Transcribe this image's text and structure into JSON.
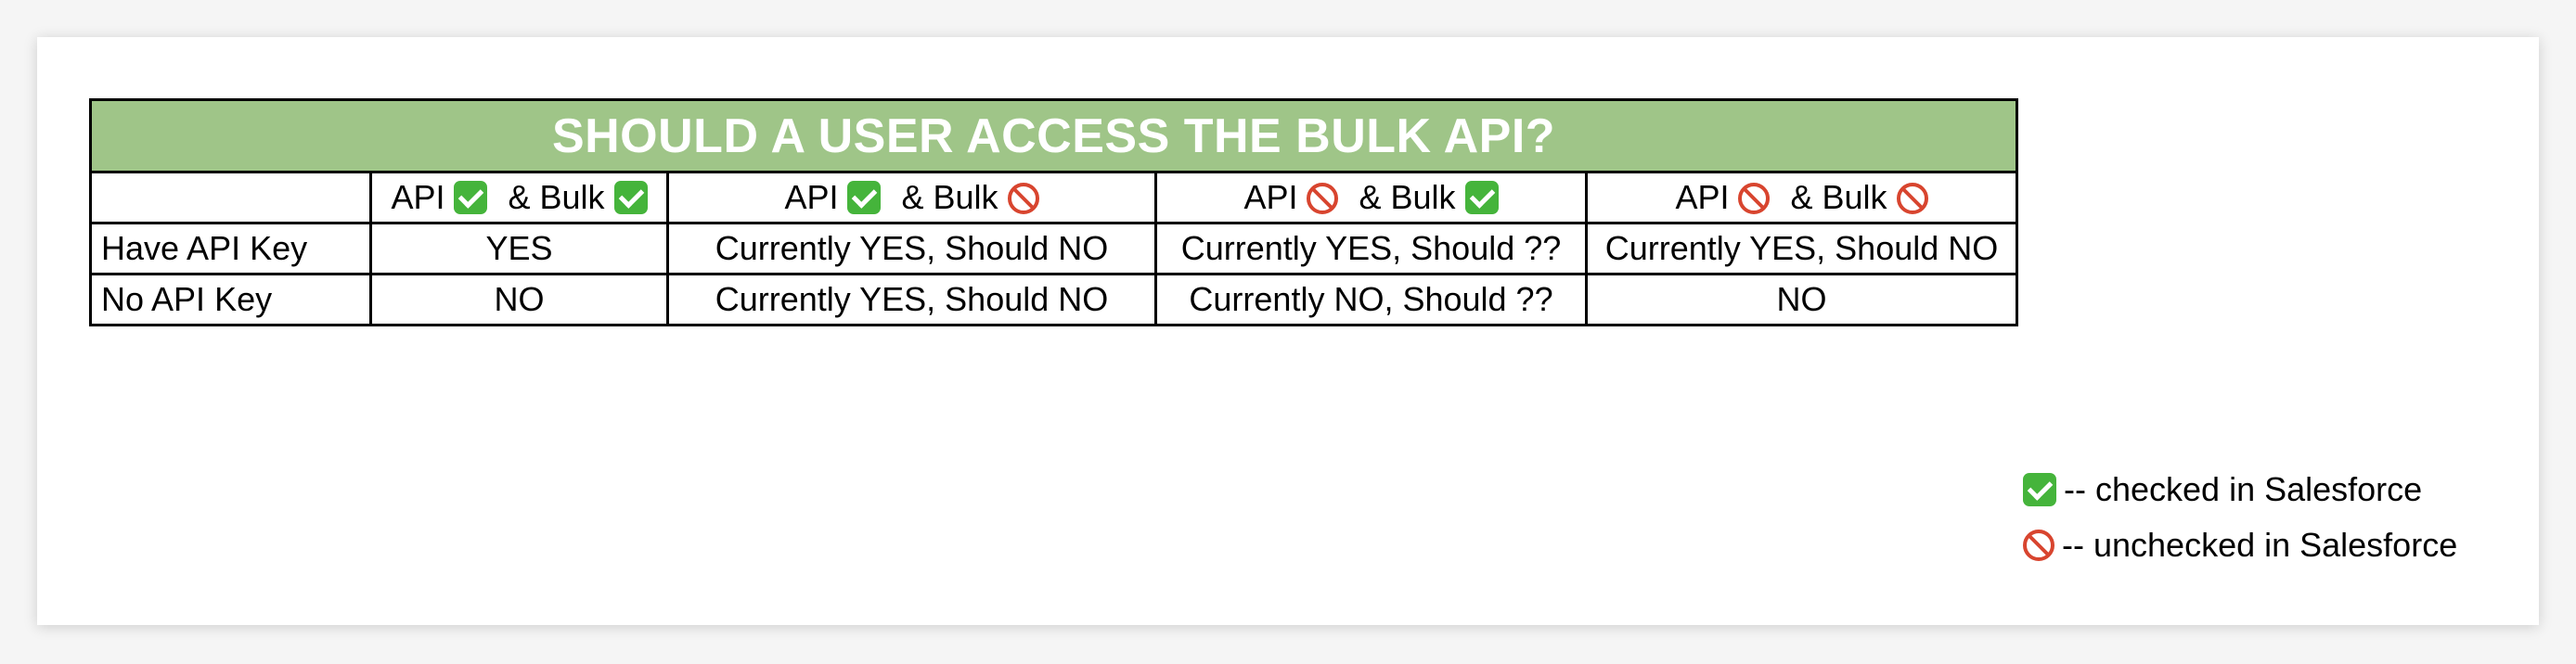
{
  "title": "SHOULD A USER ACCESS THE BULK API?",
  "columns": [
    {
      "api": "API",
      "api_icon": "checked-icon",
      "bulk": "& Bulk",
      "bulk_icon": "checked-icon"
    },
    {
      "api": "API",
      "api_icon": "checked-icon",
      "bulk": "& Bulk",
      "bulk_icon": "unchecked-icon"
    },
    {
      "api": "API",
      "api_icon": "unchecked-icon",
      "bulk": "& Bulk",
      "bulk_icon": "checked-icon"
    },
    {
      "api": "API",
      "api_icon": "unchecked-icon",
      "bulk": "& Bulk",
      "bulk_icon": "unchecked-icon"
    }
  ],
  "rows": [
    {
      "label": "Have API Key",
      "cells": [
        "YES",
        "Currently YES, Should NO",
        "Currently YES, Should ??",
        "Currently YES, Should NO"
      ]
    },
    {
      "label": "No API Key",
      "cells": [
        "NO",
        "Currently YES, Should NO",
        "Currently NO, Should ??",
        "NO"
      ]
    }
  ],
  "legend": [
    {
      "icon": "checked-icon",
      "text": "-- checked in Salesforce"
    },
    {
      "icon": "unchecked-icon",
      "text": "-- unchecked in Salesforce"
    }
  ],
  "colors": {
    "title_bg": "#9fc588",
    "checked": "#45b43b",
    "unchecked": "#d8452f"
  }
}
